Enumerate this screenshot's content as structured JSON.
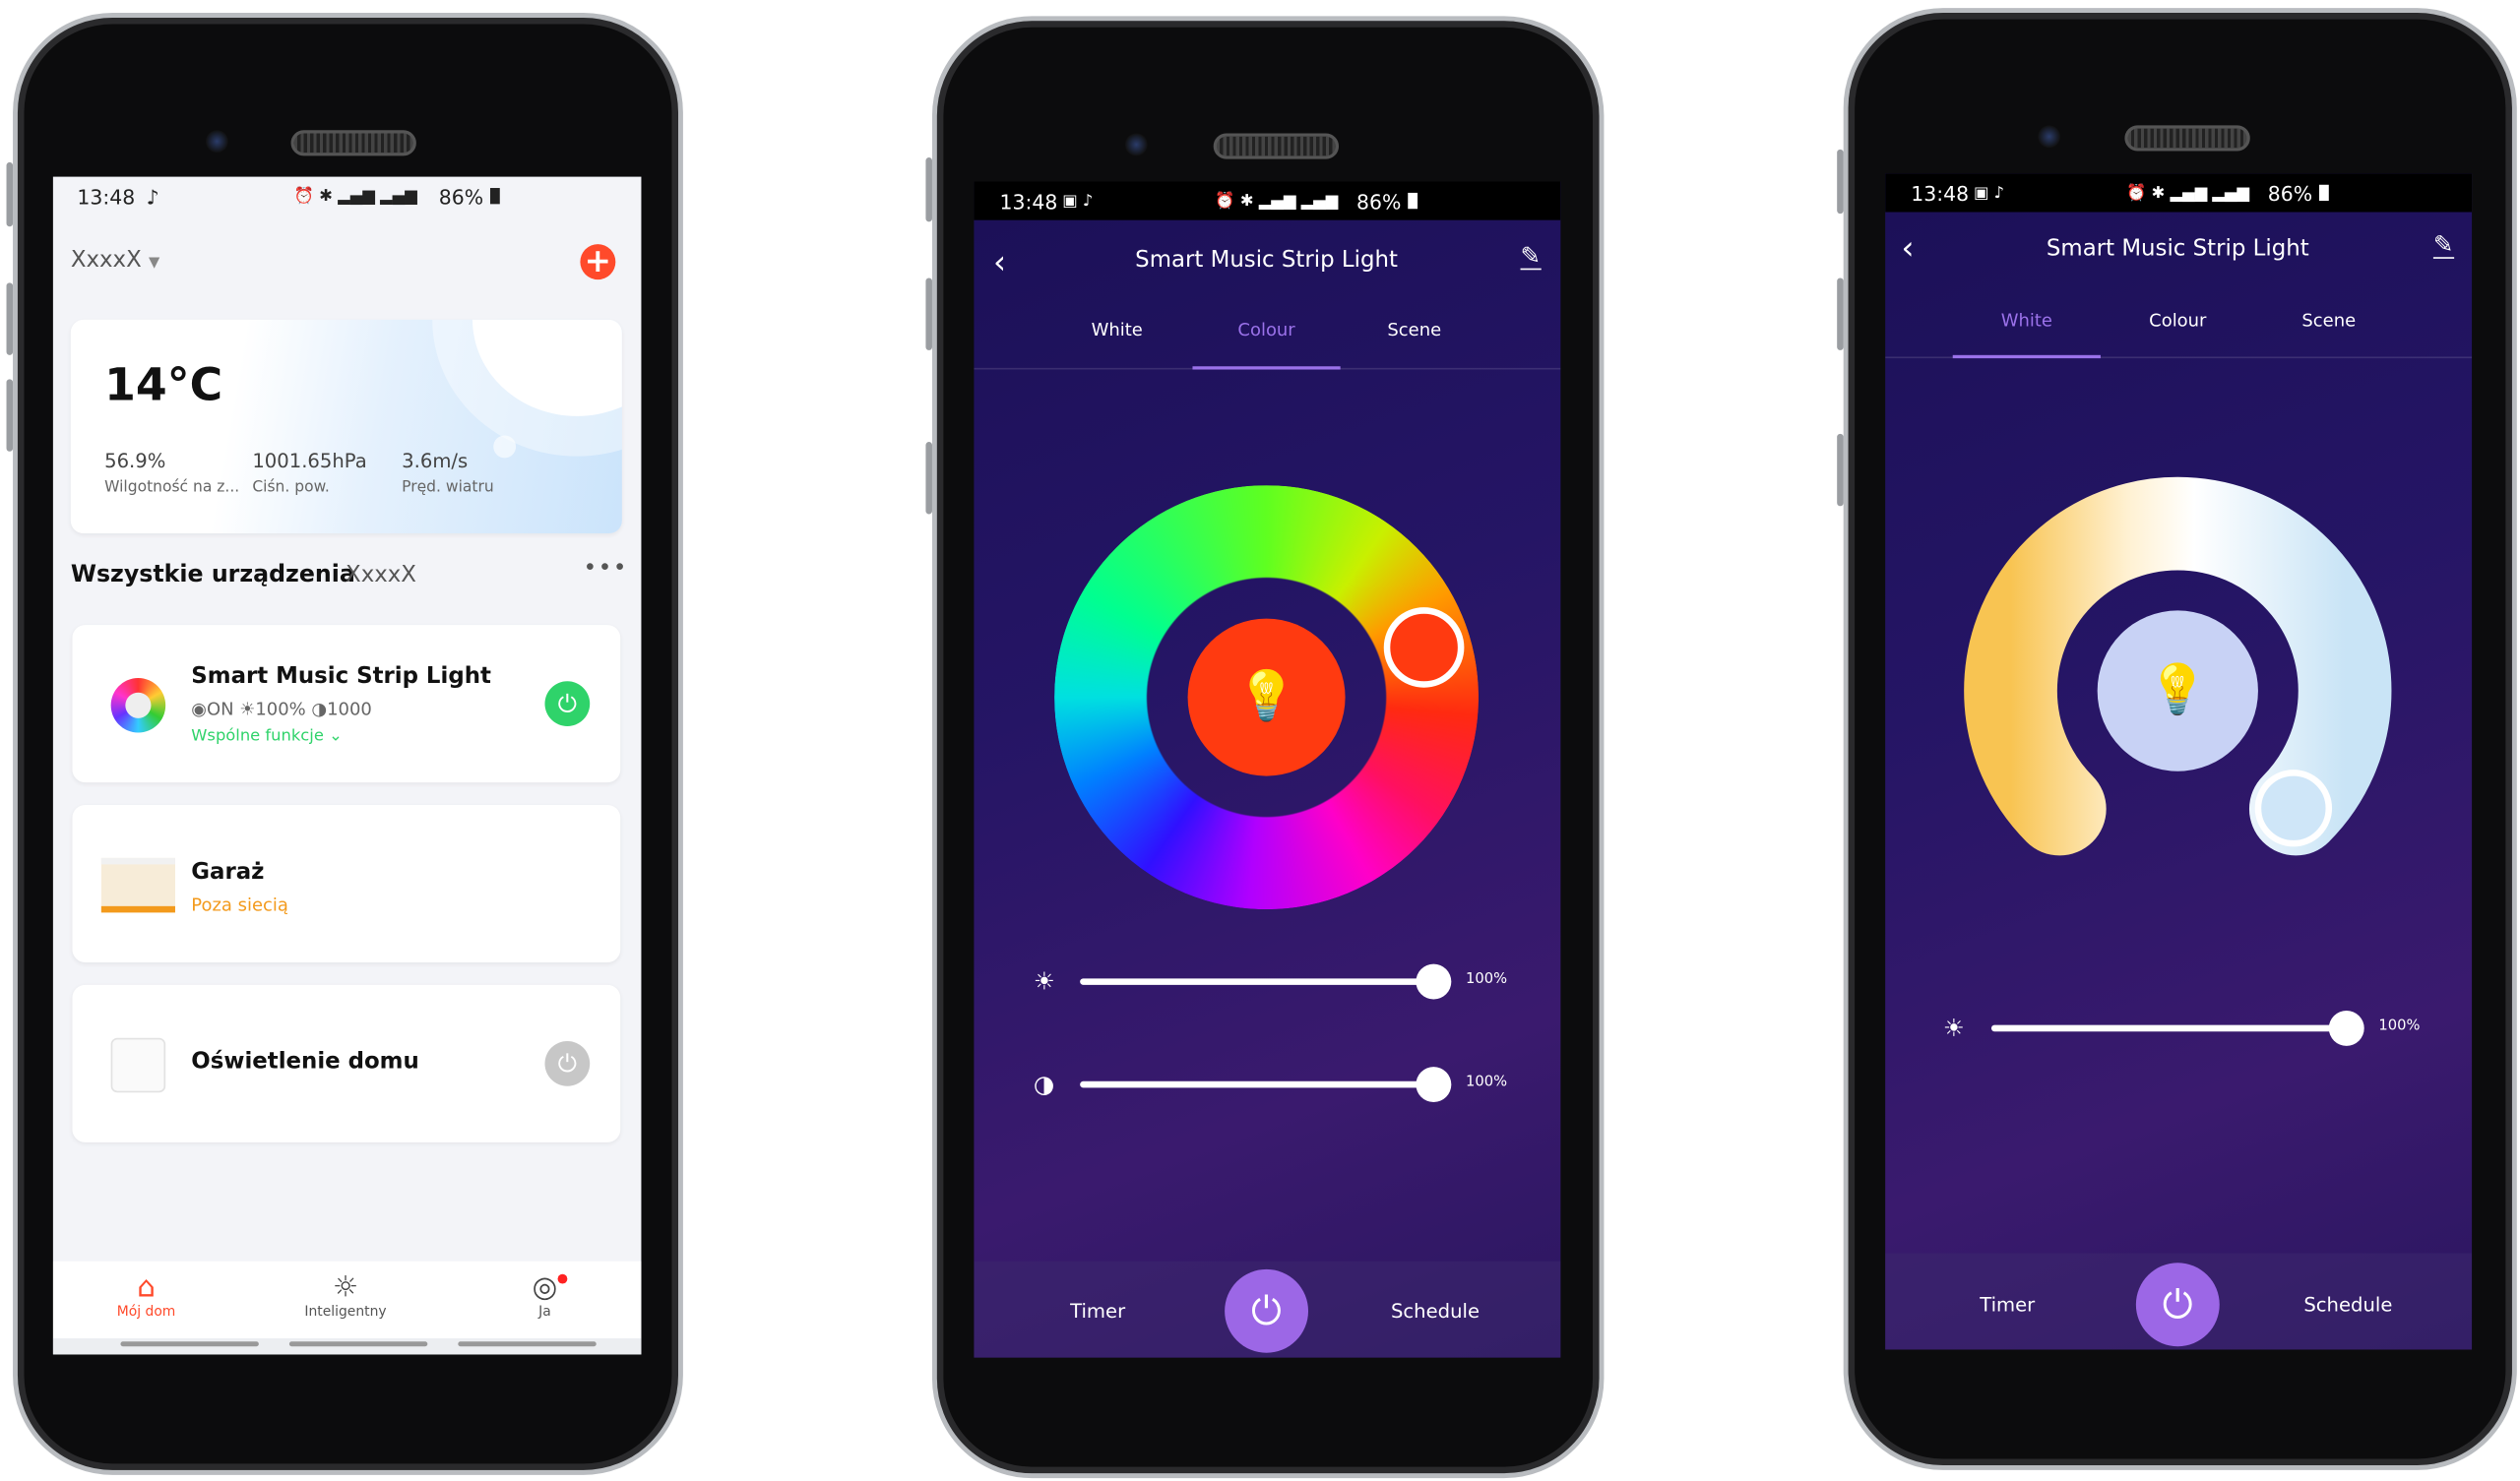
{
  "colors": {
    "accent_red": "#ff4a2b",
    "green": "#2fd36a",
    "orange": "#f39a1c",
    "purple": "#9c67e6",
    "tab_active": "#9b72ea"
  },
  "status_bar": {
    "time": "13:48",
    "battery": "86%",
    "icons": [
      "tiktok-icon",
      "alarm-icon",
      "bluetooth-icon",
      "volte-icon",
      "signal-icon",
      "lte-plus-icon",
      "signal-icon",
      "battery-icon"
    ]
  },
  "home": {
    "home_name": "XxxxX",
    "weather": {
      "temperature": "14°C",
      "stats": [
        {
          "value": "56.9%",
          "label": "Wilgotność na z..."
        },
        {
          "value": "1001.65hPa",
          "label": "Ciśn. pow."
        },
        {
          "value": "3.6m/s",
          "label": "Pręd. wiatru"
        }
      ]
    },
    "section_title": "Wszystkie urządzenia",
    "section_room": "XxxxX",
    "devices": [
      {
        "name": "Smart Music Strip Light",
        "state": "ON",
        "brightness": "100%",
        "contrast": "1000",
        "link": "Wspólne funkcje",
        "power": "on"
      },
      {
        "name": "Garaż",
        "status": "Poza siecią"
      },
      {
        "name": "Oświetlenie domu",
        "power": "off"
      }
    ],
    "nav": [
      {
        "label": "Mój dom",
        "icon": "home-icon",
        "active": true
      },
      {
        "label": "Inteligentny",
        "icon": "sun-icon"
      },
      {
        "label": "Ja",
        "icon": "profile-icon",
        "badge": true
      }
    ]
  },
  "colour_screen": {
    "title": "Smart Music Strip Light",
    "tabs": [
      "White",
      "Colour",
      "Scene"
    ],
    "active_tab": "Colour",
    "selected_color": "#ff3a10",
    "brightness": "100%",
    "saturation": "100%",
    "timer": "Timer",
    "schedule": "Schedule"
  },
  "white_screen": {
    "title": "Smart Music Strip Light",
    "tabs": [
      "White",
      "Colour",
      "Scene"
    ],
    "active_tab": "White",
    "brightness": "100%",
    "timer": "Timer",
    "schedule": "Schedule"
  }
}
